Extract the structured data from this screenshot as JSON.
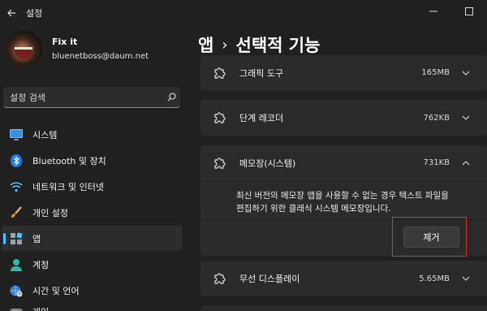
{
  "window": {
    "title": "설정"
  },
  "profile": {
    "name": "Fix it",
    "email": "bluenetboss@daum.net"
  },
  "search": {
    "placeholder": "설정 검색"
  },
  "nav": {
    "items": [
      {
        "label": "시스템",
        "icon": "system-monitor-icon"
      },
      {
        "label": "Bluetooth 및 장치",
        "icon": "bluetooth-icon"
      },
      {
        "label": "네트워크 및 인터넷",
        "icon": "wifi-icon"
      },
      {
        "label": "개인 설정",
        "icon": "brush-icon"
      },
      {
        "label": "앱",
        "icon": "apps-icon",
        "active": true
      },
      {
        "label": "계정",
        "icon": "person-icon"
      },
      {
        "label": "시간 및 언어",
        "icon": "globe-clock-icon"
      },
      {
        "label": "게임",
        "icon": "game-icon"
      }
    ]
  },
  "breadcrumb": {
    "parent": "앱",
    "separator": "›",
    "current": "선택적 기능"
  },
  "features": [
    {
      "name": "그래픽 도구",
      "size": "165MB"
    },
    {
      "name": "단계 레코더",
      "size": "762KB"
    },
    {
      "name": "메모장(시스템)",
      "size": "731KB",
      "expanded": true,
      "description": "최신 버전의 메모장 앱을 사용할 수 없는 경우 텍스트 파일을 편집하기 위한 클래식 시스템 메모장입니다.",
      "remove_label": "제거"
    },
    {
      "name": "무선 디스플레이",
      "size": "5.65MB"
    }
  ],
  "colors": {
    "background": "#202020",
    "card": "#2b2b2b",
    "accent": "#4cc2ff",
    "highlight": "#e03030"
  }
}
